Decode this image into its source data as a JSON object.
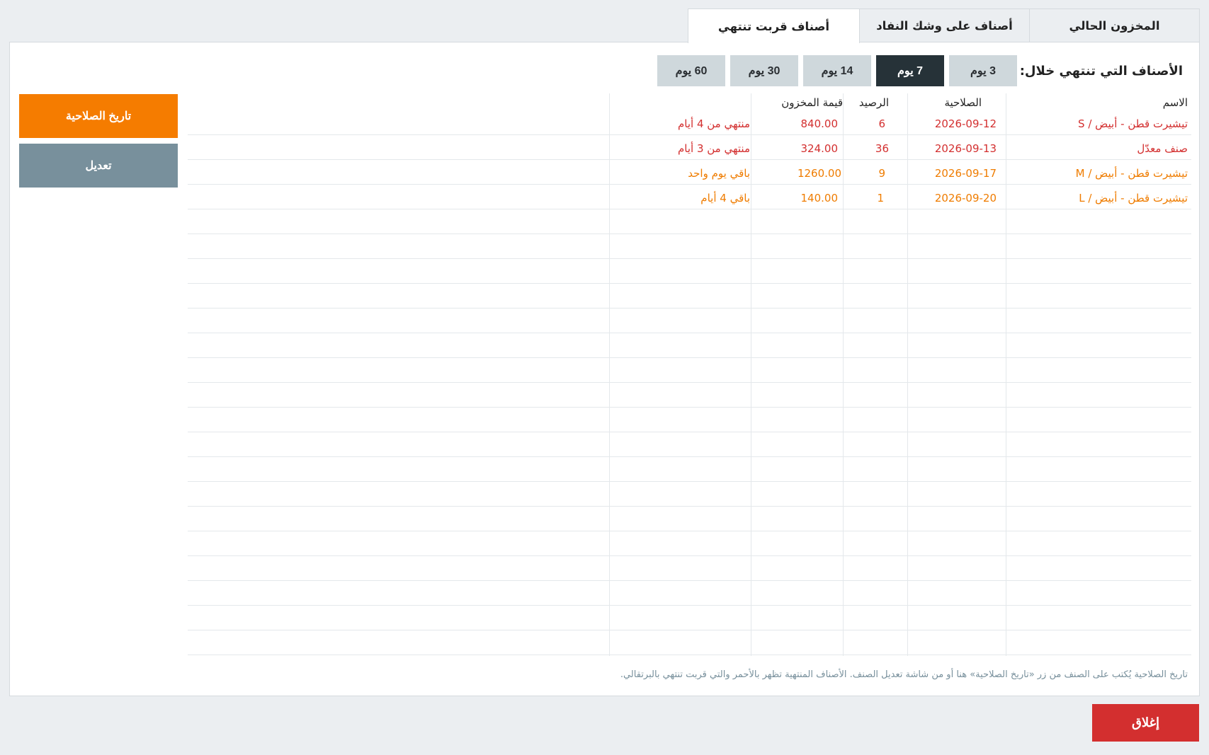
{
  "tabs": [
    {
      "label": "المخزون الحالي",
      "active": false
    },
    {
      "label": "أصناف على وشك النفاد",
      "active": false
    },
    {
      "label": "أصناف قربت تنتهي",
      "active": true
    }
  ],
  "filter": {
    "label": "الأصناف التي تنتهي خلال:",
    "options": [
      "3 يوم",
      "7 يوم",
      "14 يوم",
      "30 يوم",
      "60 يوم"
    ],
    "selected": "7 يوم"
  },
  "side_buttons": {
    "expiry": "تاريخ الصلاحية",
    "edit": "تعديل"
  },
  "table": {
    "headers": {
      "name": "الاسم",
      "expiry": "الصلاحية",
      "balance": "الرصيد",
      "value": "قيمة المخزون",
      "status": ""
    },
    "rows": [
      {
        "name": "تيشيرت قطن - أبيض / S",
        "expiry": "2026-09-12",
        "balance": "6",
        "value": "840.00",
        "status": "منتهي من 4 أيام",
        "tone": "red"
      },
      {
        "name": "صنف معدّل",
        "expiry": "2026-09-13",
        "balance": "36",
        "value": "324.00",
        "status": "منتهي من 3 أيام",
        "tone": "red"
      },
      {
        "name": "تيشيرت قطن - أبيض / M",
        "expiry": "2026-09-17",
        "balance": "9",
        "value": "1260.00",
        "status": "باقي يوم واحد",
        "tone": "orange"
      },
      {
        "name": "تيشيرت قطن - أبيض / L",
        "expiry": "2026-09-20",
        "balance": "1",
        "value": "140.00",
        "status": "باقي 4 أيام",
        "tone": "orange"
      }
    ]
  },
  "note": "تاريخ الصلاحية يُكتب على الصنف من زر «تاريخ الصلاحية» هنا أو من شاشة تعديل الصنف. الأصناف المنتهية تظهر بالأحمر والتي قربت تنتهي بالبرتقالي.",
  "close_label": "إغلاق",
  "colors": {
    "expired": "#d32f2f",
    "expiring": "#ef7c00",
    "accent": "#f57c00",
    "selected_filter": "#263238",
    "close": "#d32f2f"
  }
}
